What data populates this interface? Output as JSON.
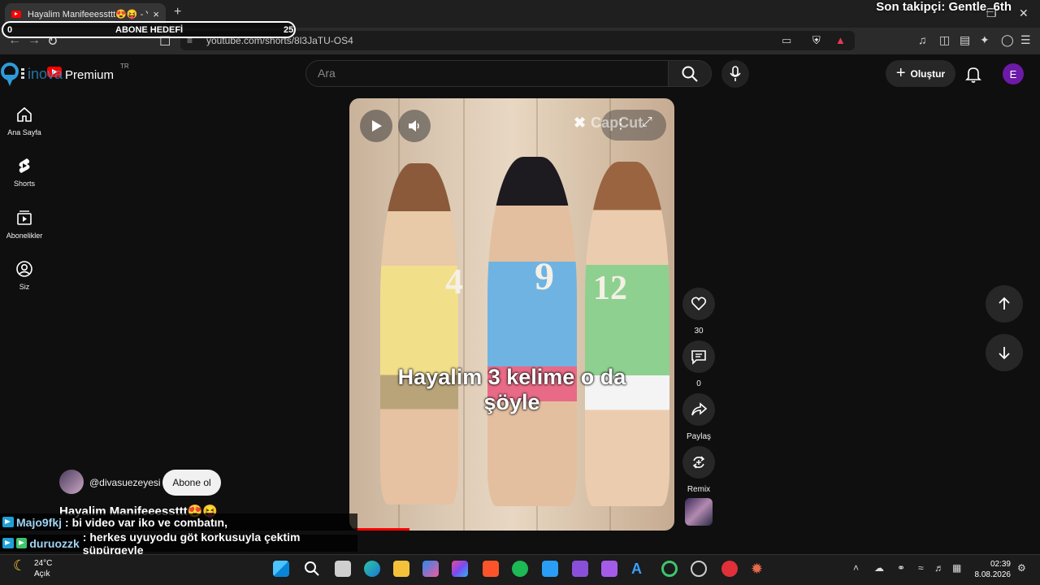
{
  "browser": {
    "tab_title": "Hayalim Manifeeessttt😍😝 - Y",
    "tab_close": "×",
    "new_tab": "+",
    "url": "youtube.com/shorts/8l3JaTU-OS4",
    "window_close": "✕",
    "window_restore": "❐"
  },
  "overlay": {
    "latest_follower": "Son takipçi: Gentle_6th",
    "goal_label": "ABONE HEDEFİ",
    "goal_current": "0",
    "goal_target": "25"
  },
  "youtube": {
    "search_placeholder": "Ara",
    "create_label": "Oluştur",
    "create_plus": "+",
    "avatar_letter": "E",
    "country": "TR"
  },
  "sidebar": {
    "items": [
      {
        "label": "Ana Sayfa"
      },
      {
        "label": "Shorts"
      },
      {
        "label": "Abonelikler"
      },
      {
        "label": "Siz"
      }
    ]
  },
  "short": {
    "caption_line1": "Hayalim 3 kelime o da",
    "caption_line2": "şöyle",
    "watermark": "CapCut",
    "jersey_numbers": [
      "4",
      "9",
      "12"
    ],
    "progress": 0.17,
    "likes": "30",
    "comments": "0",
    "share_label": "Paylaş",
    "remix_label": "Remix",
    "channel": "@divasuezeyesi",
    "subscribe_label": "Abone ol",
    "title": "Hayalim Manifeeessttt😍😝"
  },
  "chat": [
    {
      "user": "Majo9fkj",
      "message": ": bi video var iko ve combatın,"
    },
    {
      "user": "duruozzk",
      "message": ": herkes uyuyodu göt korkusuyla çektim süpürgeyle"
    }
  ],
  "taskbar": {
    "temperature": "24°C",
    "condition": "Açık",
    "time": "02:39",
    "date": "8.08.2026"
  }
}
